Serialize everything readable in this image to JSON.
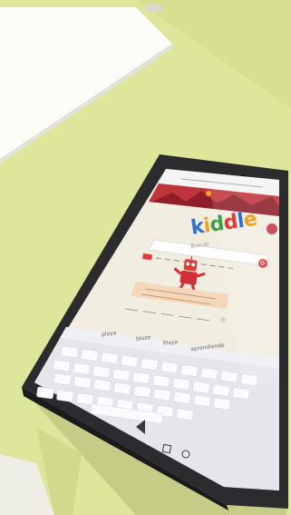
{
  "scene": {
    "colors": {
      "table": "#dde69a",
      "table_shadow": "#c9d080",
      "paper": "#fbfbf8",
      "tablet_frame": "#2c2c2f",
      "tablet_edge": "#1b1b1d",
      "screen_bg": "#f2ede1",
      "keyboard_bg": "#e5e6ea",
      "key": "#fbfbfd",
      "header_red": "#c0343c"
    }
  },
  "kiddle": {
    "logo_letters": [
      {
        "ch": "k",
        "color": "#2f6fd6"
      },
      {
        "ch": "i",
        "color": "#f0a21b"
      },
      {
        "ch": "d",
        "color": "#3aa04a"
      },
      {
        "ch": "d",
        "color": "#e23a35"
      },
      {
        "ch": "l",
        "color": "#2f6fd6"
      },
      {
        "ch": "e",
        "color": "#f0a21b"
      }
    ],
    "search_placeholder": "Buscar",
    "mascot": "robot-mascot-icon"
  },
  "keyboard": {
    "suggestions": [
      "playa",
      "blaze",
      "Playa",
      "aprendiendo"
    ]
  }
}
